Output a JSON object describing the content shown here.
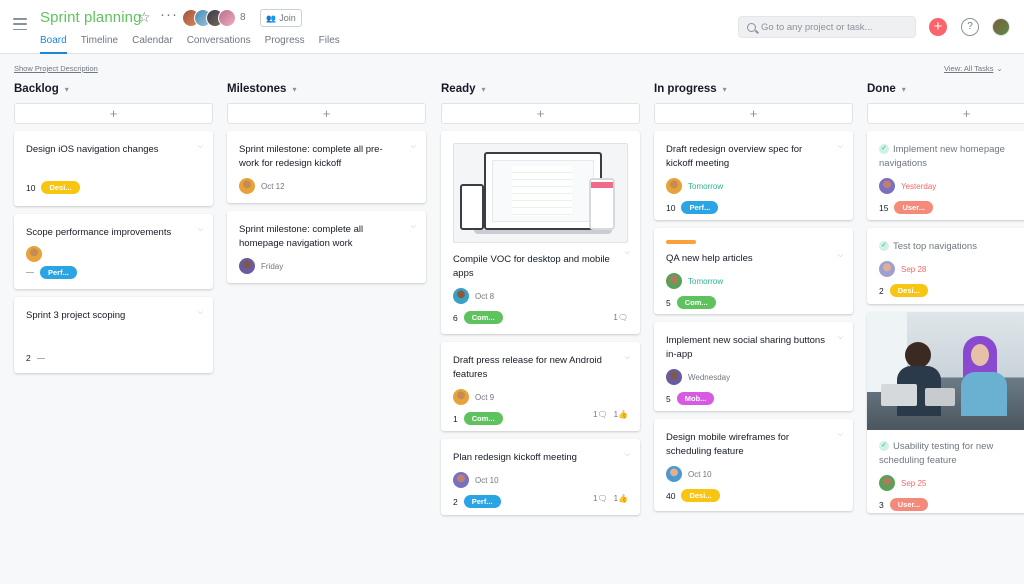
{
  "header": {
    "project_title": "Sprint planning",
    "member_count": "8",
    "join_label": "Join",
    "tabs": [
      {
        "label": "Board",
        "active": true
      },
      {
        "label": "Timeline",
        "active": false
      },
      {
        "label": "Calendar",
        "active": false
      },
      {
        "label": "Conversations",
        "active": false
      },
      {
        "label": "Progress",
        "active": false
      },
      {
        "label": "Files",
        "active": false
      }
    ],
    "search_placeholder": "Go to any project or task...",
    "help_label": "?",
    "add_label": "+",
    "icons": [
      "hamburger-menu-icon",
      "star-icon",
      "more-icon",
      "people-icon",
      "search-icon",
      "plus-icon",
      "help-icon"
    ]
  },
  "toolbar": {
    "show_description": "Show Project Description",
    "view_label": "View: All Tasks"
  },
  "colors": {
    "accent": "#1b87d6",
    "title": "#5ec35e",
    "add": "#fc636b",
    "tag_design": "#f8c511",
    "tag_perf": "#2ba4e3",
    "tag_comm": "#5ec35e",
    "tag_mobile": "#d75ae3",
    "tag_user": "#f48a7a"
  },
  "columns": [
    {
      "name": "Backlog",
      "add_label": "+",
      "cards": [
        {
          "title": "Design iOS navigation changes",
          "num": "10",
          "tag": "Desi..."
        },
        {
          "title": "Scope performance improvements",
          "tag": "Perf..."
        },
        {
          "title": "Sprint 3 project scoping",
          "num": "2"
        }
      ]
    },
    {
      "name": "Milestones",
      "add_label": "+",
      "cards": [
        {
          "title": "Sprint milestone: complete all pre-work for redesign kickoff",
          "date": "Oct 12"
        },
        {
          "title": "Sprint milestone: complete all homepage navigation work",
          "date": "Friday"
        }
      ]
    },
    {
      "name": "Ready",
      "add_label": "+",
      "cards": [
        {
          "title": "Compile VOC for desktop and mobile apps",
          "date": "Oct 8",
          "num": "6",
          "tag": "Com...",
          "comments": "1"
        },
        {
          "title": "Draft press release for new Android features",
          "date": "Oct 9",
          "num": "1",
          "tag": "Com...",
          "comments": "1",
          "likes": "1"
        },
        {
          "title": "Plan redesign kickoff meeting",
          "date": "Oct 10",
          "num": "2",
          "tag": "Perf...",
          "comments": "1",
          "likes": "1"
        }
      ]
    },
    {
      "name": "In progress",
      "add_label": "+",
      "cards": [
        {
          "title": "Draft redesign overview spec for kickoff meeting",
          "date": "Tomorrow",
          "num": "10",
          "tag": "Perf..."
        },
        {
          "title": "QA new help articles",
          "date": "Tomorrow",
          "num": "5",
          "tag": "Com..."
        },
        {
          "title": "Implement new social sharing buttons in-app",
          "date": "Wednesday",
          "num": "5",
          "tag": "Mob..."
        },
        {
          "title": "Design mobile wireframes for scheduling feature",
          "date": "Oct 10",
          "num": "40",
          "tag": "Desi..."
        }
      ]
    },
    {
      "name": "Done",
      "add_label": "+",
      "cards": [
        {
          "title": "Implement new homepage navigations",
          "date": "Yesterday",
          "num": "15",
          "tag": "User..."
        },
        {
          "title": "Test top navigations",
          "date": "Sep 28",
          "num": "2",
          "tag": "Desi..."
        },
        {
          "title": "Usability testing for new scheduling feature",
          "date": "Sep 25",
          "num": "3",
          "tag": "User..."
        }
      ]
    }
  ]
}
